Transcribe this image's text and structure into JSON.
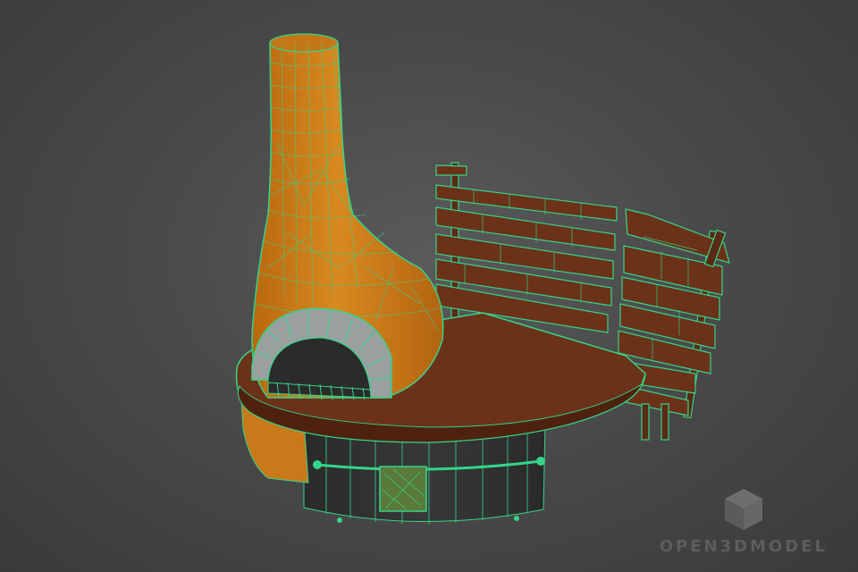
{
  "scene": {
    "description_icon": "cube-icon"
  },
  "watermark": {
    "text": "OPEN3DMODEL"
  },
  "colors": {
    "background": "#4a4a4a",
    "wire": "#35d48a",
    "chimney": "#cf7f1c",
    "chimney_dark": "#a45f10",
    "wood": "#6b3219",
    "wood_light": "#7c3d20",
    "stone": "#9aa0a0",
    "base_dark": "#2f2f2f"
  }
}
